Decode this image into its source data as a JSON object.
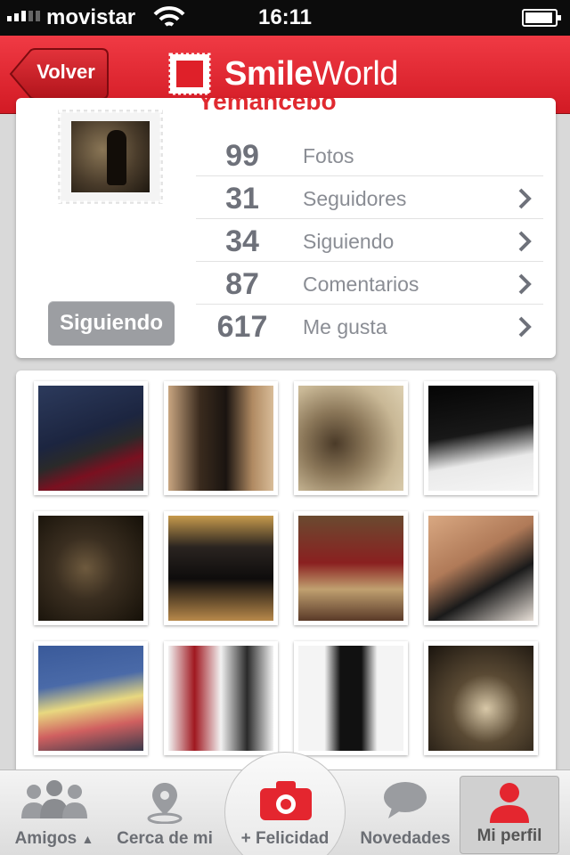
{
  "status_bar": {
    "carrier": "movistar",
    "time": "16:11"
  },
  "nav": {
    "back_label": "Volver",
    "brand_bold": "Smile",
    "brand_regular": "World",
    "accent_color": "#e4262f"
  },
  "profile": {
    "username": "Yemancebo",
    "follow_button": "Siguiendo",
    "stats": [
      {
        "value": "99",
        "label": "Fotos",
        "has_chevron": false
      },
      {
        "value": "31",
        "label": "Seguidores",
        "has_chevron": true
      },
      {
        "value": "34",
        "label": "Siguiendo",
        "has_chevron": true
      },
      {
        "value": "87",
        "label": "Comentarios",
        "has_chevron": true
      },
      {
        "value": "617",
        "label": "Me gusta",
        "has_chevron": true
      }
    ]
  },
  "photos": [
    "heels-jeans",
    "leggings-heels",
    "two-dogs-sepia",
    "black-heel-bw",
    "sepia-seated-figure",
    "black-lace-booties",
    "red-shoes-fishnet",
    "legs-black-heels",
    "colorful-sneakers",
    "red-black-boots",
    "black-tights-red-heels",
    "sepia-heels-pair"
  ],
  "tab_bar": {
    "tabs": [
      {
        "label": "Amigos",
        "icon": "friends-icon"
      },
      {
        "label": "Cerca de mi",
        "icon": "location-pin-icon"
      },
      {
        "label": "+ Felicidad",
        "icon": "camera-icon"
      },
      {
        "label": "Novedades",
        "icon": "speech-bubble-icon"
      },
      {
        "label": "Mi perfil",
        "icon": "user-icon"
      }
    ],
    "active": "Mi perfil"
  }
}
